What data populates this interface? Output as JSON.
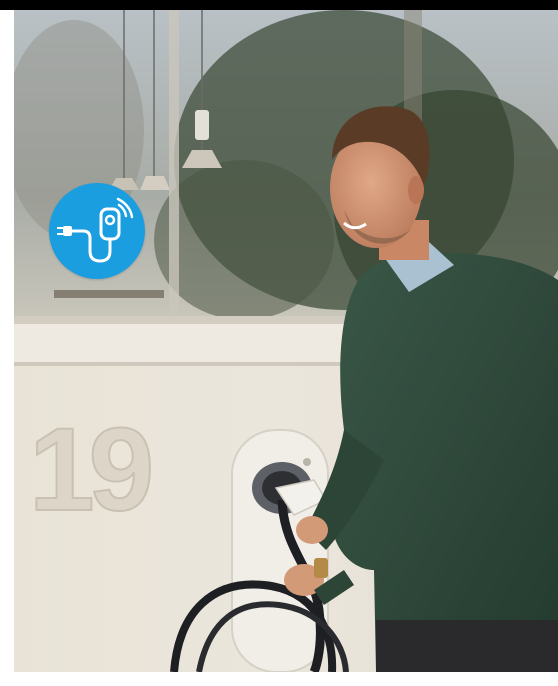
{
  "photo": {
    "house_number": "19"
  },
  "badge": {
    "icon": "ev-charger-plug-icon",
    "color": "#1a9ee0"
  },
  "colors": {
    "top_bar": "#000000",
    "wall": "#e8e2d6",
    "sweater": "#2f4a3c",
    "charger_unit": "#efece6"
  }
}
